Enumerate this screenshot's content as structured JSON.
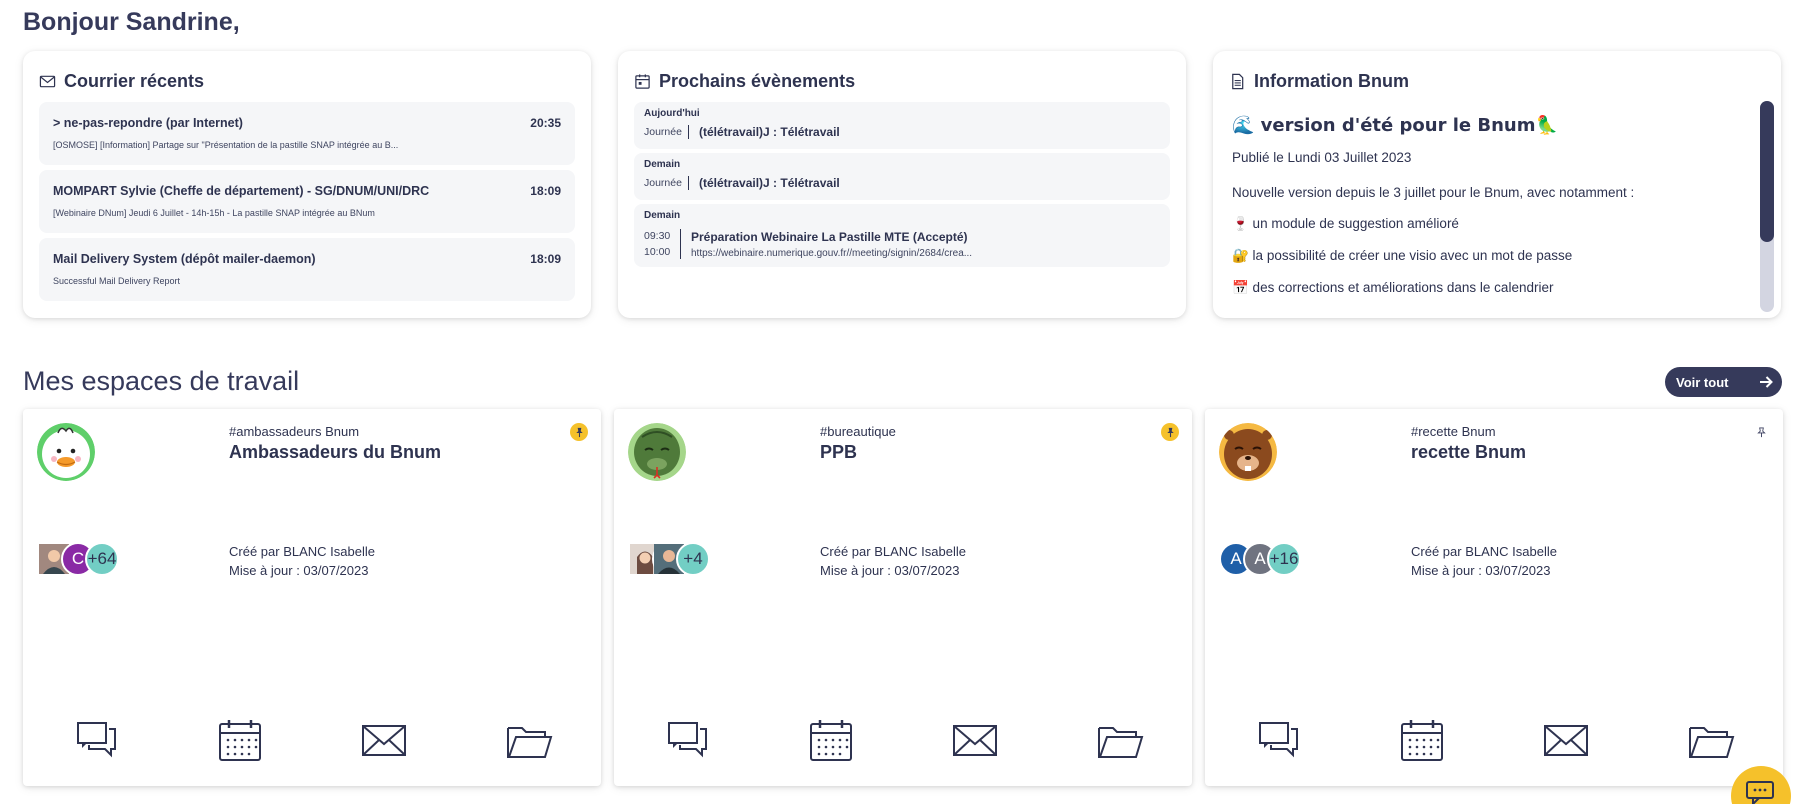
{
  "greeting": "Bonjour Sandrine,",
  "mail": {
    "title": "Courrier récents",
    "items": [
      {
        "from": "> ne-pas-repondre (par Internet)",
        "time": "20:35",
        "subject": "[OSMOSE] [Information] Partage sur \"Présentation de la pastille SNAP intégrée au B..."
      },
      {
        "from": "MOMPART Sylvie (Cheffe de département) - SG/DNUM/UNI/DRC",
        "time": "18:09",
        "subject": "[Webinaire DNum] Jeudi 6 Juillet - 14h-15h - La pastille SNAP intégrée au BNum"
      },
      {
        "from": "Mail Delivery System (dépôt mailer-daemon)",
        "time": "18:09",
        "subject": "Successful Mail Delivery Report"
      }
    ]
  },
  "events": {
    "title": "Prochains évènements",
    "days": [
      {
        "day": "Aujourd'hui",
        "range": "Journée",
        "title": "(télétravail)J : Télétravail"
      },
      {
        "day": "Demain",
        "range": "Journée",
        "title": "(télétravail)J : Télétravail"
      },
      {
        "day": "Demain",
        "start": "09:30",
        "end": "10:00",
        "title": "Préparation Webinaire La Pastille MTE (Accepté)",
        "link": "https://webinaire.numerique.gouv.fr//meeting/signin/2684/crea..."
      }
    ]
  },
  "info": {
    "title": "Information Bnum",
    "heading": "🌊 version d'été pour le Bnum🦜",
    "date": "Publié le Lundi 03 Juillet 2023",
    "intro": "Nouvelle version depuis le 3 juillet pour le Bnum, avec notamment :",
    "bullets": [
      "🍷 un module de suggestion amélioré",
      "🔐 la possibilité de créer une visio avec un mot de passe",
      "📅 des corrections et améliorations dans le calendrier"
    ],
    "scroll_fraction_visible": 0.67
  },
  "workspaces": {
    "title": "Mes espaces de travail",
    "see_all": "Voir tout",
    "cards": [
      {
        "tag": "#ambassadeurs Bnum",
        "title": "Ambassadeurs du Bnum",
        "pinned": true,
        "avatar_icon": "duck-icon",
        "members": [
          "photo",
          "C"
        ],
        "more": "+64",
        "created": "Créé par BLANC Isabelle",
        "updated": "Mise à jour : 03/07/2023"
      },
      {
        "tag": "#bureautique",
        "title": "PPB",
        "pinned": true,
        "avatar_icon": "snake-icon",
        "members": [
          "photo",
          "photo"
        ],
        "more": "+4",
        "created": "Créé par BLANC Isabelle",
        "updated": "Mise à jour : 03/07/2023"
      },
      {
        "tag": "#recette Bnum",
        "title": "recette Bnum",
        "pinned": false,
        "avatar_icon": "beaver-icon",
        "members": [
          "A",
          "A"
        ],
        "more": "+16",
        "created": "Créé par BLANC Isabelle",
        "updated": "Mise à jour : 03/07/2023"
      }
    ]
  },
  "colors": {
    "navy": "#363a5b",
    "accent_yellow": "#f5c12b",
    "teal": "#72cec4",
    "purple": "#8a2aa5",
    "blue": "#1f5fa8",
    "gray": "#6f7380"
  }
}
